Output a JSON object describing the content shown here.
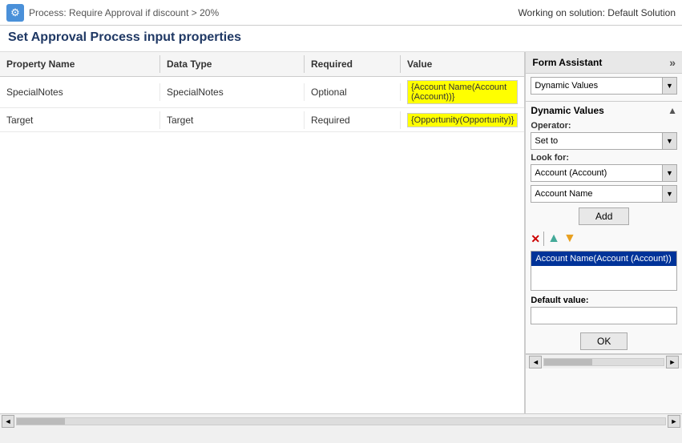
{
  "topbar": {
    "process_title": "Process: Require Approval if discount > 20%",
    "working_solution": "Working on solution: Default Solution"
  },
  "page": {
    "title": "Set Approval Process input properties"
  },
  "table": {
    "headers": [
      "Property Name",
      "Data Type",
      "Required",
      "Value"
    ],
    "rows": [
      {
        "property_name": "SpecialNotes",
        "data_type": "SpecialNotes",
        "required": "Optional",
        "value": "{Account Name(Account (Account))}"
      },
      {
        "property_name": "Target",
        "data_type": "Target",
        "required": "Required",
        "value": "{Opportunity(Opportunity)}"
      }
    ]
  },
  "form_assistant": {
    "title": "Form Assistant",
    "chevron": "»",
    "top_dropdown": "Dynamic Values",
    "dynamic_values_label": "Dynamic Values",
    "operator_label": "Operator:",
    "operator_value": "Set to",
    "look_for_label": "Look for:",
    "look_for_value": "Account (Account)",
    "field_value": "Account Name",
    "add_button": "Add",
    "selected_item": "Account Name(Account (Account))",
    "default_value_label": "Default value:",
    "ok_button": "OK"
  },
  "icons": {
    "gear": "⚙",
    "chevron_double_right": "»",
    "down_arrow": "▼",
    "x_mark": "✕",
    "up_triangle": "▲",
    "down_triangle": "▼",
    "scroll_left": "◄",
    "scroll_right": "►",
    "collapse": "▲"
  }
}
